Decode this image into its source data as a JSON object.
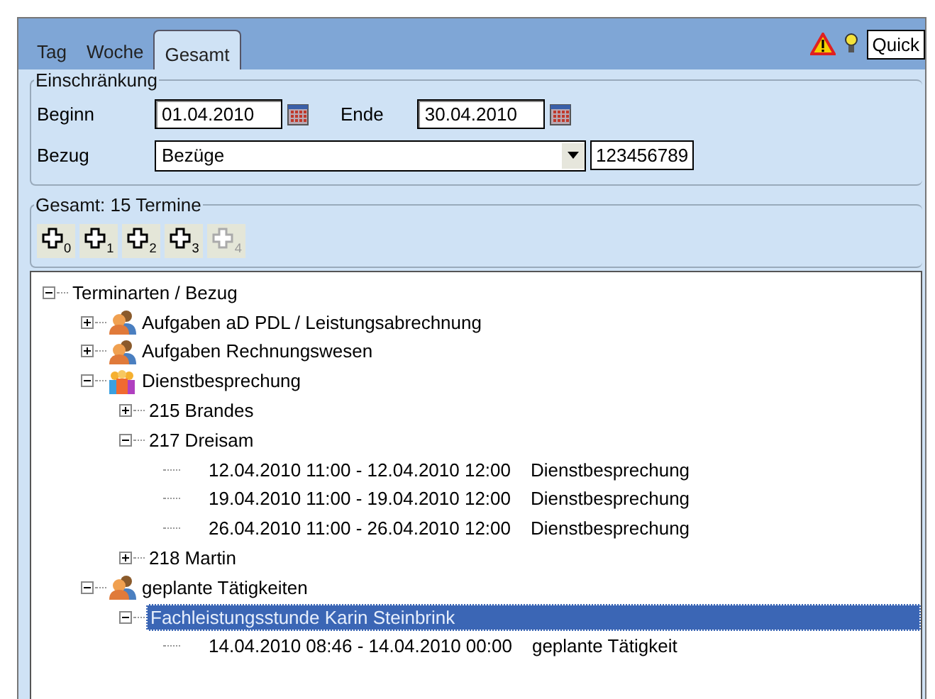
{
  "tabs": [
    {
      "label": "Tag",
      "selected": false
    },
    {
      "label": "Woche",
      "selected": false
    },
    {
      "label": "Gesamt",
      "selected": true
    }
  ],
  "toolbar": {
    "quick_field": {
      "value": "Quick"
    }
  },
  "filter": {
    "title": "Einschränkung",
    "begin": {
      "label": "Beginn",
      "value": "01.04.2010"
    },
    "end": {
      "label": "Ende",
      "value": "30.04.2010"
    },
    "reference": {
      "label": "Bezug",
      "value": "Bezüge",
      "number": "123456789"
    }
  },
  "results": {
    "title": "Gesamt: 15 Termine",
    "buttons": [
      {
        "subscript": "0",
        "disabled": false
      },
      {
        "subscript": "1",
        "disabled": false
      },
      {
        "subscript": "2",
        "disabled": false
      },
      {
        "subscript": "3",
        "disabled": false
      },
      {
        "subscript": "4",
        "disabled": true
      }
    ],
    "tree": [
      {
        "kind": "node",
        "label": "Terminarten / Bezug",
        "expanded": true,
        "selected": false,
        "children": [
          {
            "kind": "group",
            "label": "Aufgaben aD PDL / Leistungsabrechnung",
            "expanded": false,
            "selected": false
          },
          {
            "kind": "group",
            "label": "Aufgaben Rechnungswesen",
            "expanded": false,
            "selected": false
          },
          {
            "kind": "meeting",
            "label": "Dienstbesprechung",
            "expanded": true,
            "selected": false,
            "children": [
              {
                "kind": "node",
                "label": "215 Brandes",
                "expanded": false,
                "selected": false
              },
              {
                "kind": "node",
                "label": "217 Dreisam",
                "expanded": true,
                "selected": false,
                "children": [
                  {
                    "kind": "appointment",
                    "time": "12.04.2010 11:00 - 12.04.2010 12:00",
                    "subject": "Dienstbesprechung",
                    "selected": false
                  },
                  {
                    "kind": "appointment",
                    "time": "19.04.2010 11:00 - 19.04.2010 12:00",
                    "subject": "Dienstbesprechung",
                    "selected": false
                  },
                  {
                    "kind": "appointment",
                    "time": "26.04.2010 11:00 - 26.04.2010 12:00",
                    "subject": "Dienstbesprechung",
                    "selected": false
                  }
                ]
              },
              {
                "kind": "node",
                "label": "218 Martin",
                "expanded": false,
                "selected": false
              }
            ]
          },
          {
            "kind": "group",
            "label": "geplante Tätigkeiten",
            "expanded": true,
            "selected": false,
            "children": [
              {
                "kind": "node",
                "label": "Fachleistungsstunde  Karin Steinbrink",
                "expanded": true,
                "selected": true,
                "children": [
                  {
                    "kind": "appointment",
                    "time": "14.04.2010 08:46 - 14.04.2010 00:00",
                    "subject": "geplante Tätigkeit",
                    "selected": false
                  }
                ]
              }
            ]
          }
        ]
      }
    ]
  }
}
